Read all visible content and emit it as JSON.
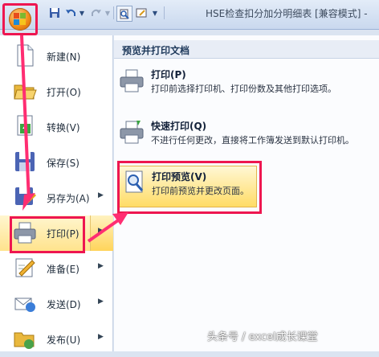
{
  "title": "HSE检查扣分加分明细表  [兼容模式]  -  ",
  "menu": {
    "items": [
      {
        "label": "新建(N)",
        "arrow": ""
      },
      {
        "label": "打开(O)",
        "arrow": ""
      },
      {
        "label": "转换(V)",
        "arrow": ""
      },
      {
        "label": "保存(S)",
        "arrow": ""
      },
      {
        "label": "另存为(A)",
        "arrow": "▶"
      },
      {
        "label": "打印(P)",
        "arrow": "▶"
      },
      {
        "label": "准备(E)",
        "arrow": "▶"
      },
      {
        "label": "发送(D)",
        "arrow": "▶"
      },
      {
        "label": "发布(U)",
        "arrow": "▶"
      }
    ]
  },
  "panel": {
    "heading": "预览并打印文档",
    "options": [
      {
        "title": "打印(P)",
        "desc": "打印前选择打印机、打印份数及其他打印选项。"
      },
      {
        "title": "快速打印(Q)",
        "desc": "不进行任何更改，直接将工作簿发送到默认打印机。"
      },
      {
        "title": "打印预览(V)",
        "desc": "打印前预览并更改页面。"
      }
    ]
  },
  "watermark": "头条号 / excel成长课堂",
  "colors": {
    "highlight": "#ffdc66",
    "annotation": "#ee1650"
  }
}
